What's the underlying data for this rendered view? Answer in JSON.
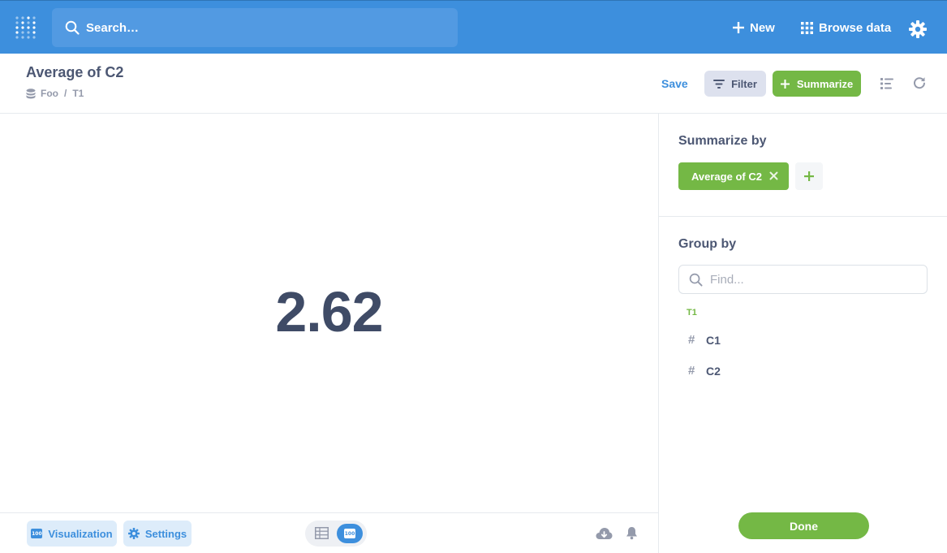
{
  "nav": {
    "search_placeholder": "Search…",
    "new_label": "New",
    "browse_label": "Browse data"
  },
  "question": {
    "title": "Average of C2",
    "breadcrumb": [
      "Foo",
      "T1"
    ],
    "save_label": "Save",
    "filter_label": "Filter",
    "summarize_label": "Summarize"
  },
  "result": {
    "value": "2.62"
  },
  "footer": {
    "visualization_label": "Visualization",
    "settings_label": "Settings",
    "badge_text": "100"
  },
  "sidebar": {
    "summarize_heading": "Summarize by",
    "aggregation_label": "Average of C2",
    "group_heading": "Group by",
    "find_placeholder": "Find...",
    "table_name": "T1",
    "fields": [
      "C1",
      "C2"
    ],
    "done_label": "Done"
  },
  "colors": {
    "brand": "#3d8fdd",
    "summarize_green": "#74b845",
    "text": "#4c5773"
  }
}
